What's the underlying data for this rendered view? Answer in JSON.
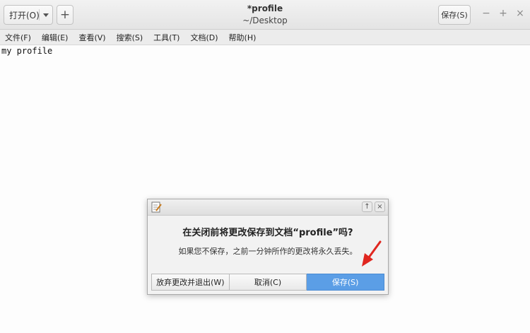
{
  "headerbar": {
    "open_label": "打开(O)",
    "new_symbol": "+",
    "title": "*profile",
    "subtitle": "~/Desktop",
    "save_label": "保存(S)",
    "minimize_symbol": "−",
    "maximize_symbol": "+",
    "close_symbol": "×"
  },
  "menubar": {
    "items": [
      "文件(F)",
      "编辑(E)",
      "查看(V)",
      "搜索(S)",
      "工具(T)",
      "文档(D)",
      "帮助(H)"
    ]
  },
  "editor": {
    "content": "my profile"
  },
  "dialog": {
    "heading": "在关闭前将更改保存到文档“profile”吗?",
    "message": "如果您不保存，之前一分钟所作的更改将永久丢失。",
    "up_symbol": "↑",
    "close_symbol": "×",
    "buttons": {
      "discard": "放弃更改并退出(W)",
      "cancel": "取消(C)",
      "save": "保存(S)"
    },
    "accent_color": "#5b9ee6"
  },
  "annotation": {
    "arrow_color": "#e0261f"
  }
}
